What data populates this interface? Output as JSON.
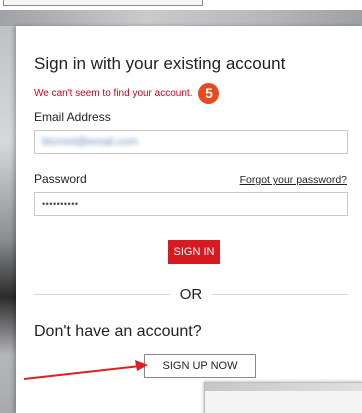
{
  "signin": {
    "title": "Sign in with your existing account",
    "error_message": "We can't seem to find your account.",
    "badge_number": "5",
    "email_label": "Email Address",
    "email_value": "blurred@email.com",
    "password_label": "Password",
    "forgot_link": "Forgot your password?",
    "password_value": "••••••••••",
    "signin_button": "SIGN IN",
    "or_divider": "OR"
  },
  "signup": {
    "prompt": "Don't have an account?",
    "button": "SIGN UP NOW"
  },
  "colors": {
    "error_red": "#d0021b",
    "badge_orange": "#e84a20",
    "button_red": "#d71920",
    "arrow_red": "#e02020"
  }
}
